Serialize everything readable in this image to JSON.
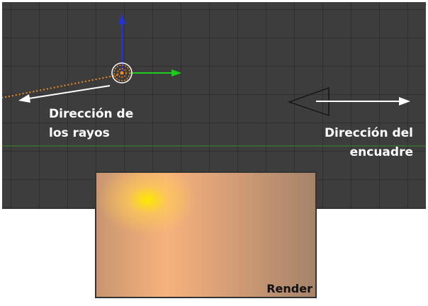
{
  "annotations": {
    "ray_direction": "Dirección de\nlos rayos",
    "frame_direction": "Dirección del\nencuadre"
  },
  "render": {
    "label": "Render"
  },
  "icons": {
    "sun_lamp": "sun-lamp-icon",
    "camera": "camera-icon",
    "gizmo_x": "x-axis-arrow-icon",
    "gizmo_z": "z-axis-arrow-icon"
  },
  "colors": {
    "viewport_bg": "#3d3d3d",
    "grid_line": "#333333",
    "horizon": "#3a8a2a",
    "x_axis": "#1ecb1e",
    "z_axis": "#2233dd",
    "lamp_orange": "#f08b1f",
    "sun_spot": "#ffe800"
  }
}
